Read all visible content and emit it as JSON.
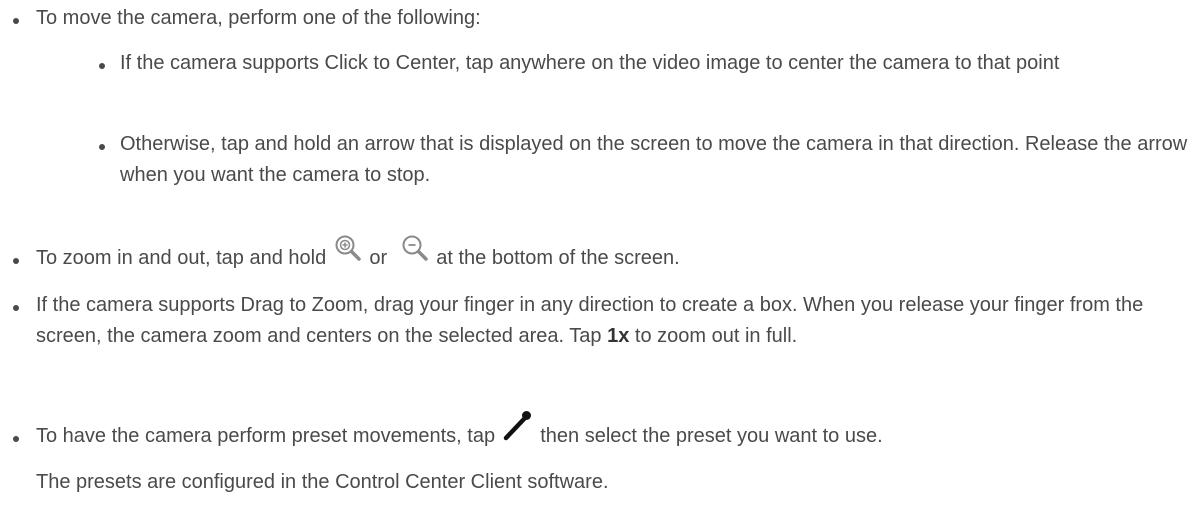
{
  "bullets": {
    "move_intro": "To move the camera, perform one of the following:",
    "move_options": [
      "If the camera supports Click to Center, tap anywhere on the video image to center the camera to that point",
      "Otherwise, tap and hold an arrow that is displayed on the screen to move the camera in that direction. Release the arrow when you want the camera to stop."
    ],
    "zoom": {
      "before": "To zoom in and out, tap and hold ",
      "or": "or",
      "after": " at the bottom of the screen.",
      "zoom_in_icon": "zoom-in-icon",
      "zoom_out_icon": "zoom-out-icon"
    },
    "drag_zoom": {
      "before": "If the camera supports Drag to Zoom, drag your finger in any direction to create a box. When you release your finger from the screen, the camera zoom and centers on the selected area. Tap ",
      "bold": "1x",
      "after": " to zoom out in full."
    },
    "preset": {
      "before": "To have the camera perform preset movements, tap ",
      "after": " then select the preset you want to use.",
      "icon": "preset-wand-icon"
    }
  },
  "note": "The presets are configured in the Control Center Client software.",
  "colors": {
    "text": "#4a4a4a",
    "icon_gray": "#8a8a8a",
    "icon_dark": "#111111"
  }
}
